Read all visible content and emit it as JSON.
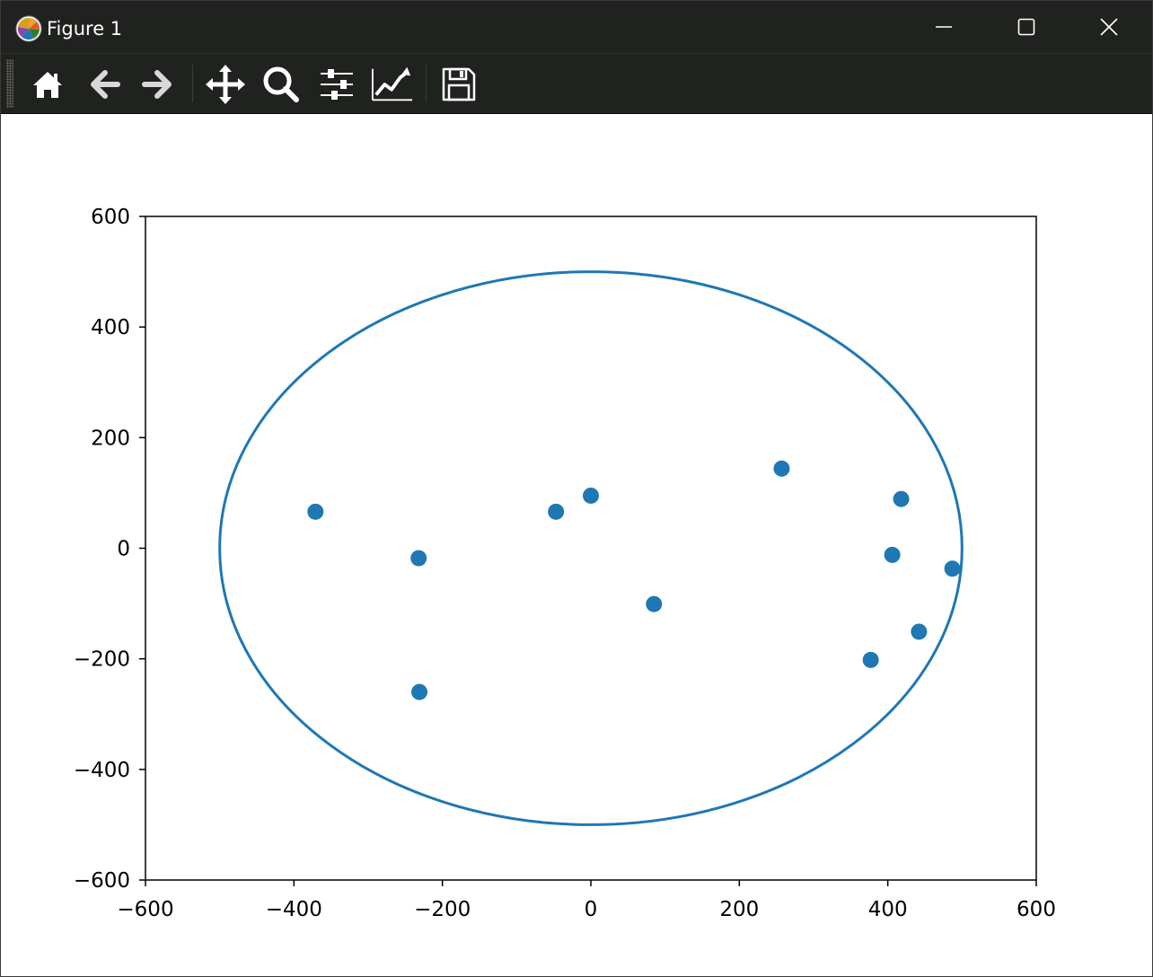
{
  "window": {
    "title": "Figure 1",
    "controls": {
      "minimize": "minimize",
      "maximize": "maximize",
      "close": "close"
    }
  },
  "toolbar": {
    "buttons": [
      {
        "name": "home",
        "icon": "home-icon",
        "tooltip": "Reset original view"
      },
      {
        "name": "back",
        "icon": "arrow-left-icon",
        "tooltip": "Back to previous view"
      },
      {
        "name": "forward",
        "icon": "arrow-right-icon",
        "tooltip": "Forward to next view"
      },
      {
        "name": "pan",
        "icon": "move-icon",
        "tooltip": "Pan axes"
      },
      {
        "name": "zoom",
        "icon": "magnifier-icon",
        "tooltip": "Zoom to rectangle"
      },
      {
        "name": "subplots",
        "icon": "sliders-icon",
        "tooltip": "Configure subplots"
      },
      {
        "name": "edit-axes",
        "icon": "line-chart-icon",
        "tooltip": "Edit axis"
      },
      {
        "name": "save",
        "icon": "floppy-disk-icon",
        "tooltip": "Save the figure"
      }
    ]
  },
  "colors": {
    "titlebar_bg": "#1f221e",
    "series": "#1f77b4",
    "axes": "#000000"
  },
  "chart_data": {
    "type": "scatter",
    "title": "",
    "xlabel": "",
    "ylabel": "",
    "xlim": [
      -600,
      600
    ],
    "ylim": [
      -600,
      600
    ],
    "xticks": [
      -600,
      -400,
      -200,
      0,
      200,
      400,
      600
    ],
    "yticks": [
      -600,
      -400,
      -200,
      0,
      200,
      400,
      600
    ],
    "grid": false,
    "circle": {
      "cx": 0,
      "cy": 0,
      "r": 500,
      "color": "#1f77b4"
    },
    "series": [
      {
        "color": "#1f77b4",
        "points": [
          {
            "x": -371,
            "y": 66
          },
          {
            "x": -232,
            "y": -18
          },
          {
            "x": -231,
            "y": -260
          },
          {
            "x": -47,
            "y": 66
          },
          {
            "x": 0,
            "y": 95
          },
          {
            "x": 85,
            "y": -101
          },
          {
            "x": 257,
            "y": 144
          },
          {
            "x": 377,
            "y": -202
          },
          {
            "x": 406,
            "y": -12
          },
          {
            "x": 418,
            "y": 89
          },
          {
            "x": 442,
            "y": -151
          },
          {
            "x": 487,
            "y": -37
          }
        ]
      }
    ]
  }
}
